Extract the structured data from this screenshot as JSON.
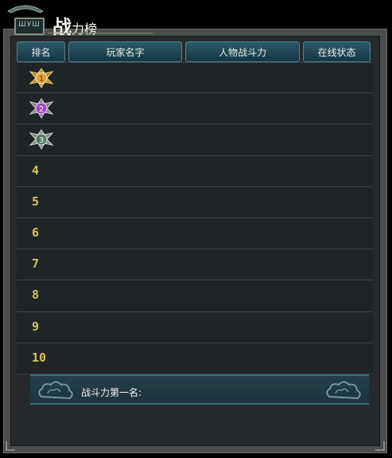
{
  "window": {
    "sign_text": "ШУШ",
    "title_big": "战",
    "title_small": "力榜"
  },
  "header": {
    "columns": [
      "排名",
      "玩家名字",
      "人物战斗力",
      "在线状态"
    ]
  },
  "ranks": [
    {
      "label": "1",
      "medal": "gold"
    },
    {
      "label": "2",
      "medal": "purple"
    },
    {
      "label": "3",
      "medal": "silver"
    },
    {
      "label": "4"
    },
    {
      "label": "5"
    },
    {
      "label": "6"
    },
    {
      "label": "7"
    },
    {
      "label": "8"
    },
    {
      "label": "9"
    },
    {
      "label": "10"
    }
  ],
  "footer": {
    "label": "战斗力第一名:"
  },
  "colors": {
    "header_bg": "#1f4a5a",
    "rank_text": "#d3c25f",
    "panel_bg": "#262a2c"
  }
}
